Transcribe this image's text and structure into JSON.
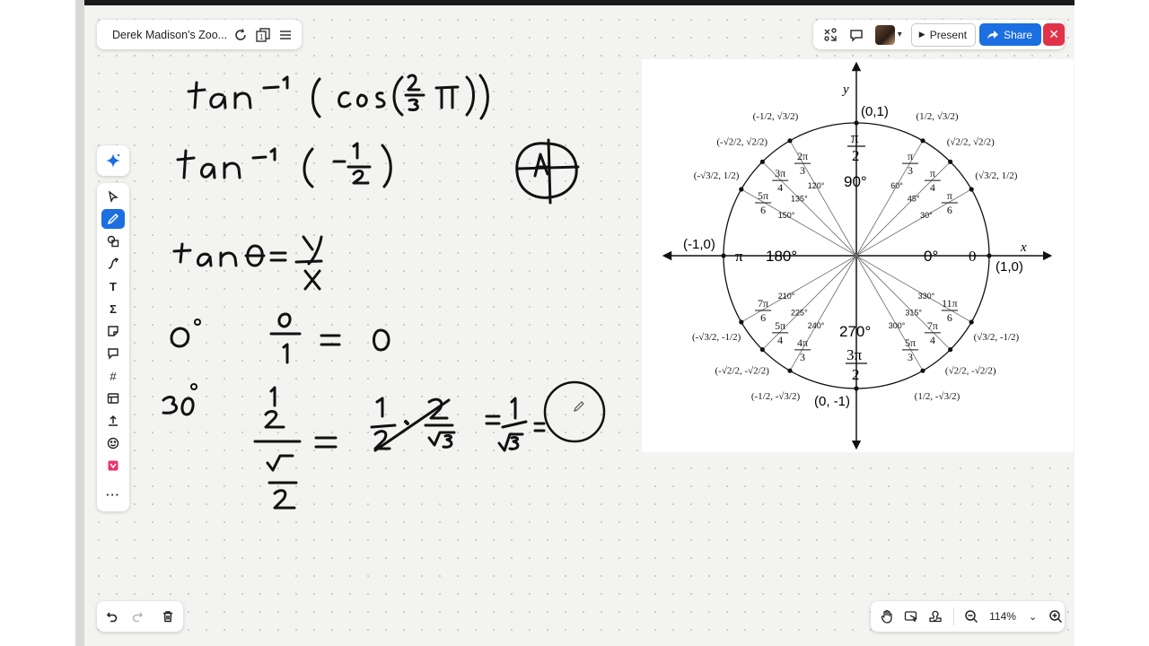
{
  "board": {
    "title": "Derek Madison's Zoo..."
  },
  "header": {
    "present_label": "Present",
    "share_label": "Share"
  },
  "zoom": {
    "level": "114%"
  },
  "handwriting": {
    "line1": "tan⁻¹ ( cos(2/3 π) )",
    "line2": "tan⁻¹ ( −1/2 )",
    "line3": "tan θ = y / x",
    "line4": "0° : 0/1 = 0",
    "line5": "30° : (1/2)/(√3/2) = 1/2 · 2/√3 = 1/√3 ="
  },
  "unit_circle": {
    "axis_x": "x",
    "axis_y": "y",
    "points": {
      "top": "(0,1)",
      "bottom": "(0, -1)",
      "left": "(-1,0)",
      "right": "(1,0)"
    },
    "degrees_major": {
      "top": "90°",
      "left": "180°",
      "right": "0°",
      "bottom": "270°"
    },
    "radians_axis": {
      "top_num": "π",
      "top_den": "2",
      "left": "π",
      "right": "0",
      "bottom_num": "3π",
      "bottom_den": "2"
    },
    "angles": [
      {
        "deg": "30°",
        "rad_num": "π",
        "rad_den": "6",
        "coord_x": "√3/2",
        "coord_y": "1/2"
      },
      {
        "deg": "45°",
        "rad_num": "π",
        "rad_den": "4",
        "coord_x": "√2/2",
        "coord_y": "√2/2"
      },
      {
        "deg": "60°",
        "rad_num": "π",
        "rad_den": "3",
        "coord_x": "1/2",
        "coord_y": "√3/2"
      },
      {
        "deg": "120°",
        "rad_num": "2π",
        "rad_den": "3",
        "coord_x": "-1/2",
        "coord_y": "√3/2"
      },
      {
        "deg": "135°",
        "rad_num": "3π",
        "rad_den": "4",
        "coord_x": "-√2/2",
        "coord_y": "√2/2"
      },
      {
        "deg": "150°",
        "rad_num": "5π",
        "rad_den": "6",
        "coord_x": "-√3/2",
        "coord_y": "1/2"
      },
      {
        "deg": "210°",
        "rad_num": "7π",
        "rad_den": "6",
        "coord_x": "-√3/2",
        "coord_y": "-1/2"
      },
      {
        "deg": "225°",
        "rad_num": "5π",
        "rad_den": "4",
        "coord_x": "-√2/2",
        "coord_y": "-√2/2"
      },
      {
        "deg": "240°",
        "rad_num": "4π",
        "rad_den": "3",
        "coord_x": "-1/2",
        "coord_y": "-√3/2"
      },
      {
        "deg": "300°",
        "rad_num": "5π",
        "rad_den": "3",
        "coord_x": "1/2",
        "coord_y": "-√3/2"
      },
      {
        "deg": "315°",
        "rad_num": "7π",
        "rad_den": "4",
        "coord_x": "√2/2",
        "coord_y": "-√2/2"
      },
      {
        "deg": "330°",
        "rad_num": "11π",
        "rad_den": "6",
        "coord_x": "√3/2",
        "coord_y": "-1/2"
      }
    ]
  }
}
